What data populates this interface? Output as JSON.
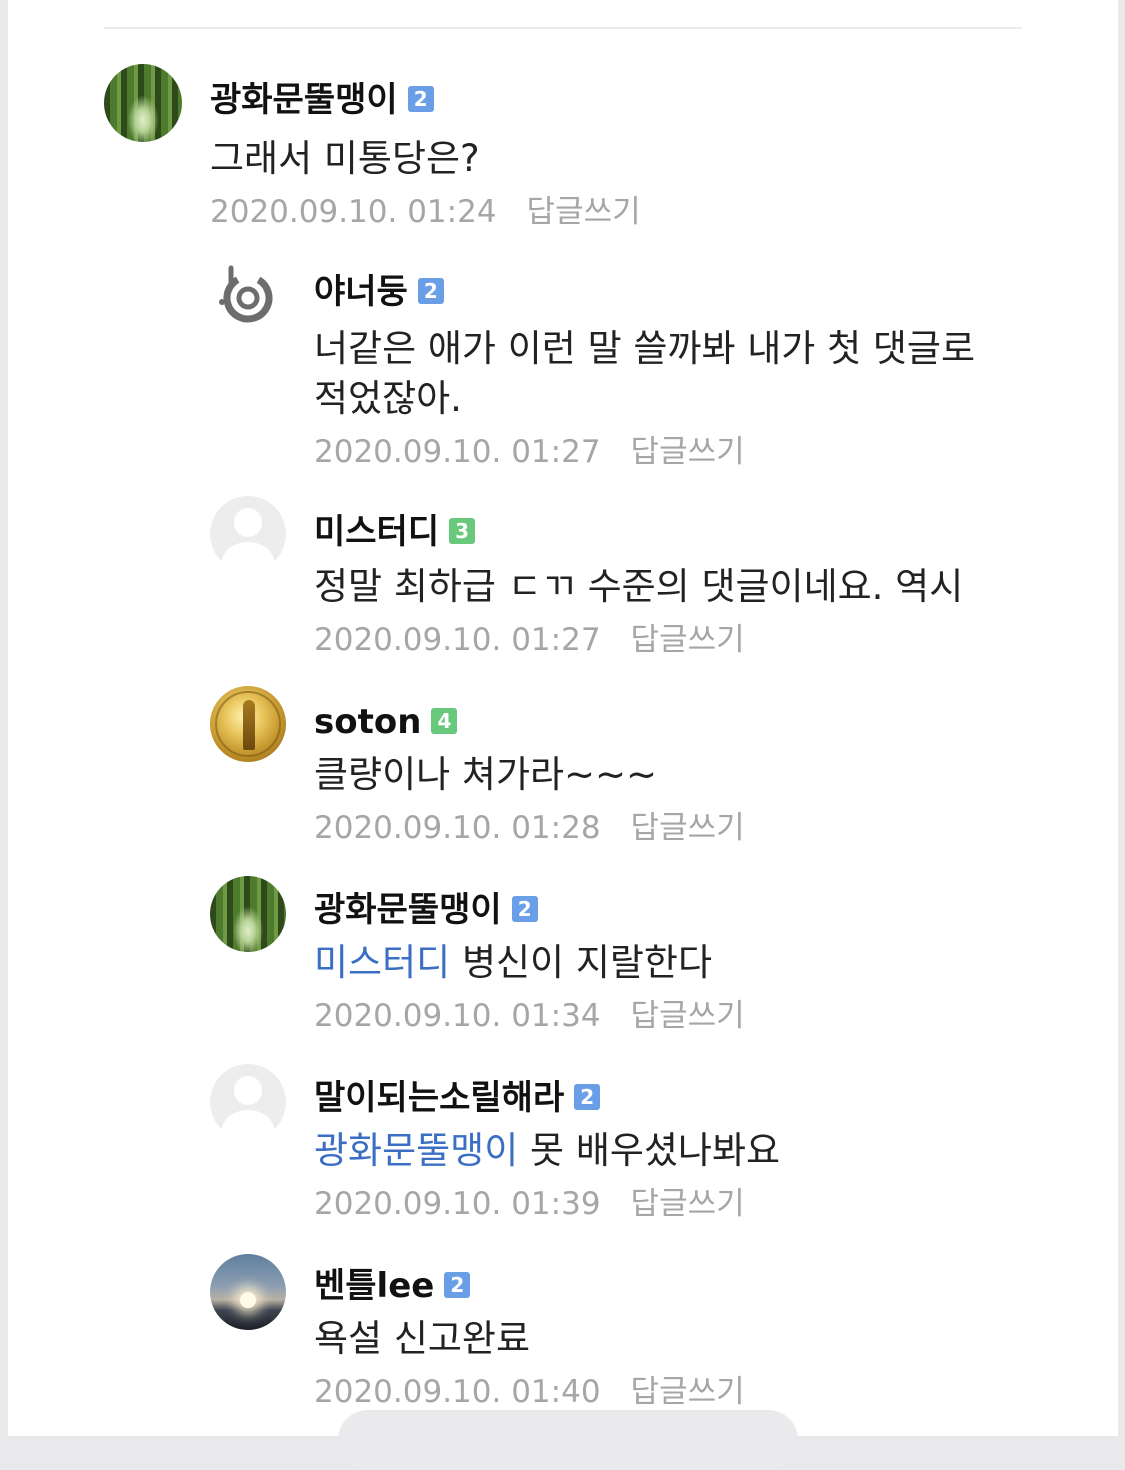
{
  "comments": [
    {
      "nickname": "광화문뚤맹이",
      "level": "2",
      "text": "그래서 미통당은?",
      "timestamp": "2020.09.10. 01:24",
      "reply_label": "답글쓰기"
    },
    {
      "nickname": "야너둥",
      "level": "2",
      "text_line1": "너같은 애가 이런 말 쓸까봐 내가 첫 댓글로",
      "text_line2": "적었잖아.",
      "timestamp": "2020.09.10. 01:27",
      "reply_label": "답글쓰기"
    },
    {
      "nickname": "미스터디",
      "level": "3",
      "text": "정말 최하급 ㄷㄲ 수준의 댓글이네요. 역시",
      "timestamp": "2020.09.10. 01:27",
      "reply_label": "답글쓰기"
    },
    {
      "nickname": "soton",
      "level": "4",
      "text": "클량이나 쳐가라~~~",
      "timestamp": "2020.09.10. 01:28",
      "reply_label": "답글쓰기"
    },
    {
      "nickname": "광화문뚤맹이",
      "level": "2",
      "mention": "미스터디",
      "text": "병신이 지랄한다",
      "timestamp": "2020.09.10. 01:34",
      "reply_label": "답글쓰기"
    },
    {
      "nickname": "말이되는소릴해라",
      "level": "2",
      "mention": "광화문뚤맹이",
      "text": "못 배우셨나봐요",
      "timestamp": "2020.09.10. 01:39",
      "reply_label": "답글쓰기"
    },
    {
      "nickname": "벤틀lee",
      "level": "2",
      "text": "욕설 신고완료",
      "timestamp": "2020.09.10. 01:40",
      "reply_label": "답글쓰기"
    }
  ],
  "colors": {
    "mention": "#3b6fc4",
    "badge_blue": "#6a9fe8",
    "badge_green": "#68c97c",
    "meta_gray": "#a6a6a6"
  }
}
